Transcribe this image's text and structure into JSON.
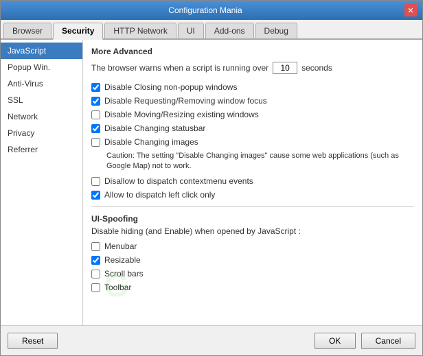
{
  "window": {
    "title": "Configuration Mania"
  },
  "tabs": [
    {
      "label": "Browser",
      "active": false
    },
    {
      "label": "Security",
      "active": true
    },
    {
      "label": "HTTP Network",
      "active": false
    },
    {
      "label": "UI",
      "active": false
    },
    {
      "label": "Add-ons",
      "active": false
    },
    {
      "label": "Debug",
      "active": false
    }
  ],
  "sidebar": {
    "items": [
      {
        "label": "JavaScript",
        "active": true
      },
      {
        "label": "Popup Win.",
        "active": false
      },
      {
        "label": "Anti-Virus",
        "active": false
      },
      {
        "label": "SSL",
        "active": false
      },
      {
        "label": "Network",
        "active": false
      },
      {
        "label": "Privacy",
        "active": false
      },
      {
        "label": "Referrer",
        "active": false
      }
    ]
  },
  "main": {
    "section_title": "More Advanced",
    "timeout_label_before": "The browser warns when a script is running over",
    "timeout_value": "10",
    "timeout_label_after": "seconds",
    "checkboxes": [
      {
        "label": "Disable Closing non-popup windows",
        "checked": true
      },
      {
        "label": "Disable Requesting/Removing window focus",
        "checked": true
      },
      {
        "label": "Disable Moving/Resizing existing windows",
        "checked": false
      },
      {
        "label": "Disable Changing statusbar",
        "checked": true
      },
      {
        "label": "Disable Changing images",
        "checked": false
      }
    ],
    "caution": "Caution: The setting \"Disable Changing images\" cause some web applications (such as Google Map) not to work.",
    "checkboxes2": [
      {
        "label": "Disallow to dispatch contextmenu events",
        "checked": false
      },
      {
        "label": "Allow to dispatch left click only",
        "checked": true
      }
    ],
    "ui_spoofing": {
      "title": "UI-Spoofing",
      "description": "Disable hiding (and Enable) when opened by JavaScript :",
      "items": [
        {
          "label": "Menubar",
          "checked": false
        },
        {
          "label": "Resizable",
          "checked": true
        },
        {
          "label": "Scroll bars",
          "checked": false
        },
        {
          "label": "Toolbar",
          "checked": false
        }
      ]
    }
  },
  "footer": {
    "reset_label": "Reset",
    "ok_label": "OK",
    "cancel_label": "Cancel"
  }
}
